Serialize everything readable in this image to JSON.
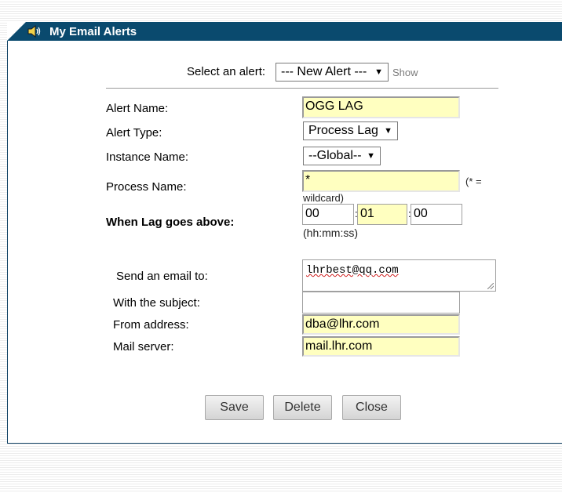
{
  "window": {
    "title": "My Email Alerts",
    "icon": "speaker-icon"
  },
  "selector": {
    "label": "Select an alert:",
    "selected": "--- New Alert ---",
    "show_link": "Show"
  },
  "form": {
    "alert_name": {
      "label": "Alert Name:",
      "value": "OGG LAG"
    },
    "alert_type": {
      "label": "Alert Type:",
      "selected": "Process Lag"
    },
    "instance_name": {
      "label": "Instance Name:",
      "selected": "--Global--"
    },
    "process_name": {
      "label": "Process Name:",
      "value": "*",
      "hint_a": "(* =",
      "hint_b": "wildcard)"
    },
    "lag": {
      "label": "When Lag goes above:",
      "hh": "00",
      "mm": "01",
      "ss": "00",
      "sep": ":",
      "format_hint": "(hh:mm:ss)"
    },
    "send_to": {
      "label": "Send an email to:",
      "value": "lhrbest@qq.com"
    },
    "subject": {
      "label": "With the subject:",
      "value": ""
    },
    "from_address": {
      "label": "From address:",
      "value": "dba@lhr.com"
    },
    "mail_server": {
      "label": "Mail server:",
      "value": "mail.lhr.com"
    }
  },
  "buttons": {
    "save": "Save",
    "delete": "Delete",
    "close": "Close"
  },
  "colors": {
    "titlebar": "#0a4a6e",
    "field_highlight": "#ffffc0"
  }
}
